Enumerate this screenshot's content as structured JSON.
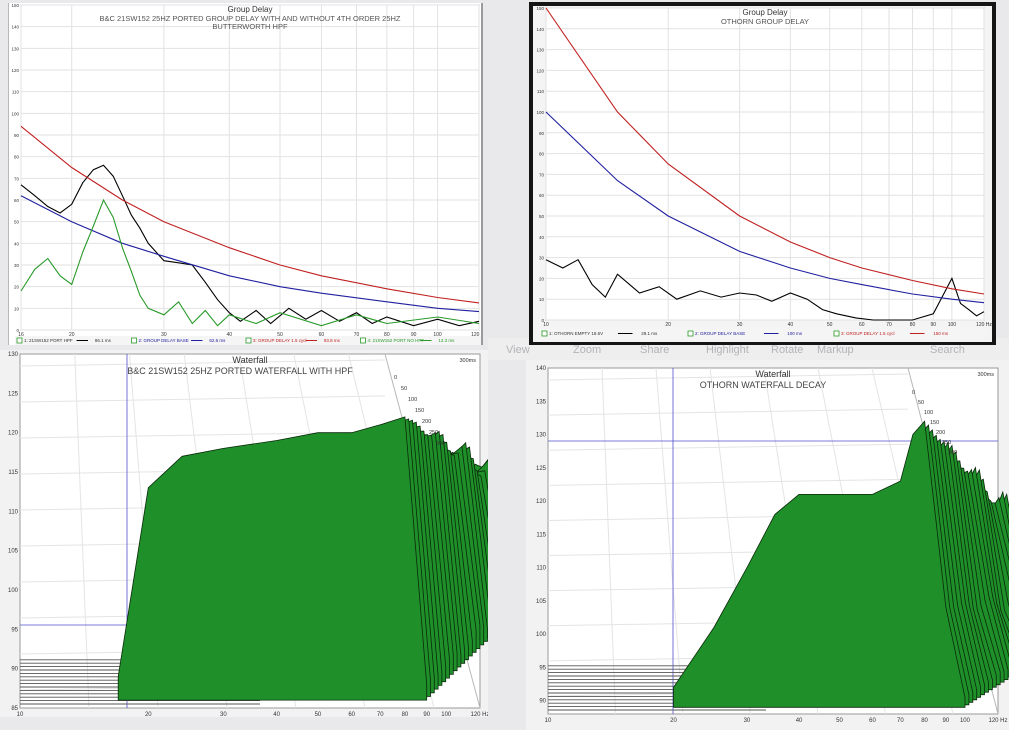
{
  "toolbar": {
    "view": "View",
    "zoom": "Zoom",
    "share": "Share",
    "highlight": "Highlight",
    "rotate": "Rotate",
    "markup": "Markup",
    "search": "Search"
  },
  "chart_data": [
    {
      "type": "line",
      "title": "Group Delay",
      "subtitle": "B&C 21SW152 25HZ PORTED GROUP DELAY WITH AND WITHOUT 4TH ORDER 25HZ BUTTERWORTH HPF",
      "x_scale": "log",
      "xlim": [
        16,
        120
      ],
      "ylim": [
        0,
        150
      ],
      "x_ticks": [
        16,
        20,
        30,
        40,
        50,
        60,
        70,
        80,
        90,
        100,
        120
      ],
      "x_tick_labels": [
        "16",
        "20",
        "30",
        "40",
        "50",
        "60",
        "70",
        "80",
        "90",
        "100",
        "120 Hz"
      ],
      "y_ticks": [
        0,
        10,
        20,
        30,
        40,
        50,
        60,
        70,
        80,
        90,
        100,
        110,
        120,
        130,
        140,
        150
      ],
      "grid": true,
      "legend_position": "bottom",
      "series": [
        {
          "name": "1: 21SW152 PORT HPF",
          "legend_value": "86.1 ms",
          "color": "#000000",
          "x": [
            16,
            17,
            18,
            19,
            20,
            21,
            22,
            23,
            24,
            25,
            26,
            27,
            28,
            30,
            32,
            34,
            36,
            38,
            40,
            42,
            45,
            48,
            52,
            56,
            60,
            65,
            70,
            75,
            80,
            90,
            100,
            110,
            120
          ],
          "y": [
            67,
            62,
            57,
            54,
            58,
            68,
            74,
            76,
            71,
            62,
            53,
            47,
            40,
            32,
            31,
            30,
            22,
            14,
            8,
            4,
            9,
            3,
            10,
            5,
            9,
            4,
            8,
            3,
            6,
            2,
            5,
            2,
            4
          ]
        },
        {
          "name": "2: GROUP DELAY BASE",
          "legend_value": "62.6 ms",
          "color": "#2020a0",
          "x": [
            16,
            20,
            25,
            30,
            40,
            50,
            60,
            80,
            100,
            120
          ],
          "y": [
            62,
            50,
            40,
            34,
            25,
            20,
            17,
            13,
            10,
            8.5
          ]
        },
        {
          "name": "3: GROUP DELAY 1.5 cycl",
          "legend_value": "93.8 ms",
          "color": "#c02020",
          "x": [
            16,
            20,
            25,
            30,
            40,
            50,
            60,
            80,
            100,
            120
          ],
          "y": [
            94,
            75,
            60,
            50,
            38,
            30,
            25,
            19,
            15,
            12.5
          ]
        },
        {
          "name": "4: 21SW152 PORT NO HPF",
          "legend_value": "13.3 ms",
          "color": "#2a9a2a",
          "x": [
            16,
            17,
            18,
            19,
            20,
            21,
            22,
            23,
            24,
            25,
            26,
            27,
            28,
            30,
            32,
            34,
            36,
            38,
            40,
            45,
            50,
            60,
            70,
            80,
            100,
            120
          ],
          "y": [
            18,
            28,
            33,
            25,
            21,
            36,
            48,
            60,
            52,
            38,
            27,
            16,
            10,
            7,
            13,
            3,
            9,
            2,
            7,
            3,
            8,
            2,
            7,
            3,
            6,
            3
          ]
        }
      ]
    },
    {
      "type": "line",
      "title": "Group Delay",
      "subtitle": "OTHORN GROUP DELAY",
      "x_scale": "log",
      "xlim": [
        10,
        120
      ],
      "ylim": [
        0,
        150
      ],
      "x_ticks": [
        10,
        20,
        30,
        40,
        50,
        60,
        70,
        80,
        90,
        100,
        120
      ],
      "x_tick_labels": [
        "10",
        "20",
        "30",
        "40",
        "50",
        "60",
        "70",
        "80",
        "90",
        "100",
        "120 Hz"
      ],
      "y_ticks": [
        0,
        10,
        20,
        30,
        40,
        50,
        60,
        70,
        80,
        90,
        100,
        110,
        120,
        130,
        140,
        150
      ],
      "grid": true,
      "legend_position": "bottom",
      "series": [
        {
          "name": "1: OTHORN EMPTY 18.6V",
          "legend_value": "29.1 ms",
          "color": "#000000",
          "x": [
            10,
            11,
            12,
            13,
            14,
            15,
            17,
            19,
            21,
            24,
            27,
            30,
            33,
            36,
            40,
            44,
            48,
            52,
            58,
            64,
            70,
            80,
            90,
            100,
            105,
            110,
            115,
            120
          ],
          "y": [
            29,
            25,
            29,
            17,
            11,
            22,
            13,
            16,
            10,
            14,
            11,
            13,
            12,
            9,
            13,
            10,
            5,
            3,
            1,
            0,
            0,
            0,
            3,
            20,
            8,
            5,
            2,
            4
          ]
        },
        {
          "name": "2: GROUP DELAY BASE",
          "legend_value": "100 ms",
          "color": "#2020a0",
          "x": [
            10,
            15,
            20,
            30,
            40,
            50,
            60,
            80,
            100,
            120
          ],
          "y": [
            100,
            67,
            50,
            33,
            25,
            20,
            17,
            12.5,
            10,
            8.3
          ]
        },
        {
          "name": "3: GROUP DELAY 1.5 cycl",
          "legend_value": "150 ms",
          "color": "#c02020",
          "x": [
            10,
            15,
            20,
            30,
            40,
            50,
            60,
            80,
            100,
            120
          ],
          "y": [
            150,
            100,
            75,
            50,
            37.5,
            30,
            25,
            19,
            15,
            12.5
          ]
        }
      ]
    },
    {
      "type": "area",
      "title": "Waterfall",
      "subtitle": "B&C 21SW152 25HZ PORTED WATERFALL WITH HPF",
      "x_scale": "log",
      "xlim": [
        10,
        120
      ],
      "ylim": [
        85,
        130
      ],
      "x_tick_labels": [
        "10",
        "20",
        "30",
        "40",
        "50",
        "60",
        "70",
        "80",
        "90",
        "100",
        "120 Hz"
      ],
      "y_tick_labels": [
        "85",
        "90",
        "95",
        "100",
        "105",
        "110",
        "115",
        "120",
        "125",
        "130"
      ],
      "time_ms": [
        0,
        50,
        100,
        150,
        200,
        250,
        300
      ],
      "time_labels": [
        "0",
        "50",
        "100",
        "150",
        "200",
        "250",
        "300",
        "300ms"
      ],
      "fill_color": "#1f8f2a",
      "front_slice": {
        "x": [
          17,
          20,
          24,
          30,
          40,
          50,
          60,
          70,
          80,
          90
        ],
        "y": [
          89,
          113,
          117,
          118,
          119,
          120,
          120,
          121,
          122,
          88
        ]
      }
    },
    {
      "type": "area",
      "title": "Waterfall",
      "subtitle": "OTHORN WATERFALL DECAY",
      "x_scale": "log",
      "xlim": [
        10,
        120
      ],
      "ylim": [
        88,
        140
      ],
      "x_tick_labels": [
        "10",
        "20",
        "30",
        "40",
        "50",
        "60",
        "70",
        "80",
        "90",
        "100",
        "120 Hz"
      ],
      "y_tick_labels": [
        "90",
        "95",
        "100",
        "105",
        "110",
        "115",
        "120",
        "125",
        "130",
        "135",
        "140"
      ],
      "time_ms": [
        0,
        50,
        100,
        150,
        200,
        250,
        300
      ],
      "time_labels": [
        "0",
        "50",
        "100",
        "150",
        "200",
        "250",
        "300",
        "300ms"
      ],
      "fill_color": "#1f8f2a",
      "front_slice": {
        "x": [
          20,
          25,
          30,
          35,
          40,
          50,
          60,
          70,
          75,
          80,
          90,
          100
        ],
        "y": [
          92,
          101,
          110,
          118,
          121,
          121,
          121,
          123,
          130,
          132,
          104,
          90
        ]
      }
    }
  ]
}
